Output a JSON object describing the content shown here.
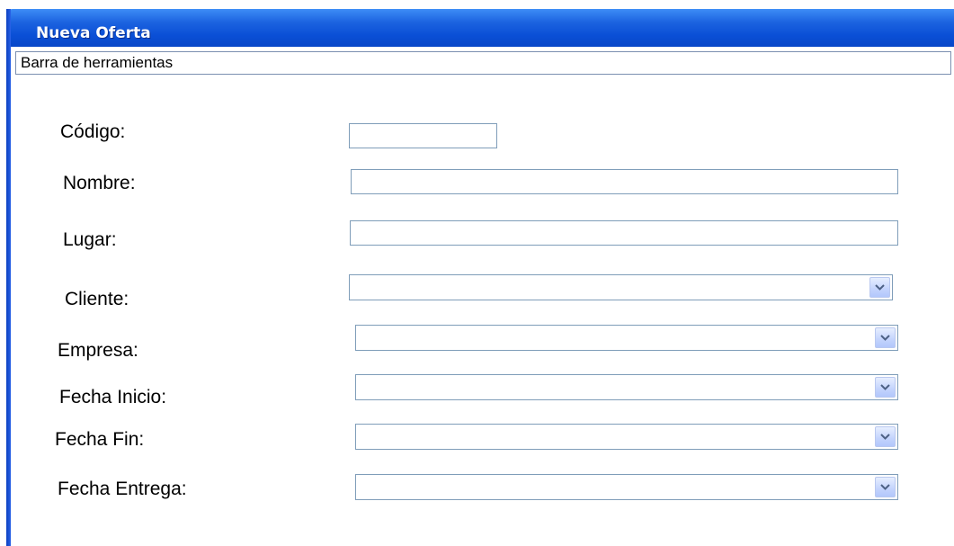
{
  "window": {
    "title": "Nueva Oferta"
  },
  "toolbar": {
    "label": "Barra de herramientas"
  },
  "form": {
    "codigo": {
      "label": "Código:",
      "value": ""
    },
    "nombre": {
      "label": "Nombre:",
      "value": ""
    },
    "lugar": {
      "label": "Lugar:",
      "value": ""
    },
    "cliente": {
      "label": "Cliente:",
      "value": ""
    },
    "empresa": {
      "label": "Empresa:",
      "value": ""
    },
    "fecha_inicio": {
      "label": "Fecha Inicio:",
      "value": ""
    },
    "fecha_fin": {
      "label": "Fecha Fin:",
      "value": ""
    },
    "fecha_entrega": {
      "label": "Fecha Entrega:",
      "value": ""
    }
  },
  "icons": {
    "dropdown": "chevron-down-icon"
  },
  "colors": {
    "title_bar": "#0a4fd6",
    "input_border": "#7f9db9",
    "dropdown_button": "#c3d3fd"
  }
}
